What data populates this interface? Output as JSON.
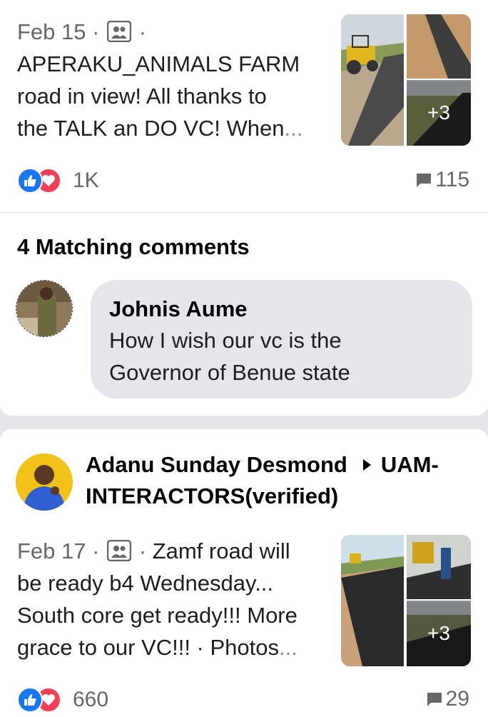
{
  "post1": {
    "date": "Feb 15",
    "text_line1_after_icon": "·",
    "text_line2": "APERAKU_ANIMALS FARM",
    "text_line3": "road in view! All thanks to",
    "text_line4": "the TALK an DO VC!  When",
    "ellipsis": "...",
    "more_photos": "+3",
    "reaction_count": "1K",
    "comment_count": "115"
  },
  "matching": {
    "heading": "4 Matching comments",
    "comment": {
      "author": "Johnis Aume",
      "line1": "How I wish our vc is the",
      "line2": "Governor of Benue state"
    }
  },
  "post2": {
    "author": "Adanu Sunday Desmond",
    "group_line1": "UAM-",
    "group_line2": "INTERACTORS(verified)",
    "date": "Feb 17",
    "line1_rest": "Zamf road will",
    "line2": "be ready b4 Wednesday...",
    "line3": "South core get ready!!! More",
    "line4": "grace to our VC!!! · Photos",
    "ellipsis": "...",
    "more_photos": "+3",
    "reaction_count": "660",
    "comment_count": "29"
  },
  "sep": "·",
  "icons": [
    "group-photo-icon",
    "like-icon",
    "love-icon",
    "comment-icon",
    "play-triangle-icon"
  ],
  "colors": {
    "like": "#1877f2",
    "love": "#f33e58",
    "muted": "#65676b",
    "bubble": "#e4e6eb"
  }
}
